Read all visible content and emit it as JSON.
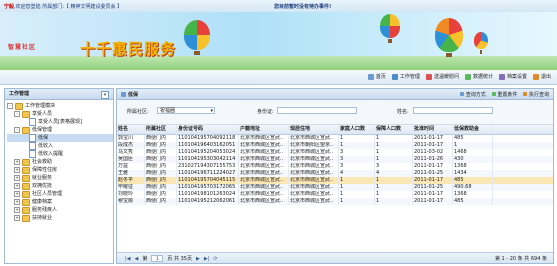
{
  "topbar": {
    "greeting_user": "宁毅",
    "greeting_rest": ",欢迎您登陆  所属部门:【 精神文明建设委员会 】",
    "notice": "您目前暂时没有待办事件!"
  },
  "banner": {
    "slogan": "智慧社区",
    "title": "十千惠民服务"
  },
  "toolbar": {
    "items": [
      "首页",
      "工作管理",
      "送温暖慰问",
      "数据统计",
      "档案设置",
      "退出"
    ]
  },
  "sidebar": {
    "title": "工作管理",
    "tree": [
      {
        "label": "工作管理模块",
        "level": 0,
        "type": "folder",
        "exp": "-"
      },
      {
        "label": "享受人员",
        "level": 1,
        "type": "folder",
        "exp": "-"
      },
      {
        "label": "享受人员[表格展现]",
        "level": 2,
        "type": "page"
      },
      {
        "label": "低保管理",
        "level": 1,
        "type": "folder",
        "exp": "-"
      },
      {
        "label": "低保",
        "level": 2,
        "type": "page",
        "selected": true
      },
      {
        "label": "低收入",
        "level": 2,
        "type": "page"
      },
      {
        "label": "低收入提醒",
        "level": 2,
        "type": "page"
      },
      {
        "label": "社会救助",
        "level": 1,
        "type": "folder",
        "exp": "+"
      },
      {
        "label": "保障性住房",
        "level": 1,
        "type": "folder",
        "exp": "+"
      },
      {
        "label": "就业服务",
        "level": 1,
        "type": "folder",
        "exp": "+"
      },
      {
        "label": "双拥优抚",
        "level": 1,
        "type": "folder",
        "exp": "+"
      },
      {
        "label": "社区人员管理",
        "level": 1,
        "type": "folder",
        "exp": "+"
      },
      {
        "label": "健康档案",
        "level": 1,
        "type": "folder",
        "exp": "+"
      },
      {
        "label": "服务残疾人",
        "level": 1,
        "type": "folder",
        "exp": "+"
      },
      {
        "label": "扶持就业",
        "level": 1,
        "type": "folder",
        "exp": "+"
      }
    ]
  },
  "main": {
    "title": "低保",
    "actions": [
      "查询方式",
      "重置条件",
      "执行查询"
    ],
    "filter": {
      "community_label": "所属社区:",
      "community_value": "祝福圈",
      "id_label": "身份证:",
      "name_label": "姓名:"
    },
    "columns": [
      "姓名",
      "所属社区",
      "身份证号码",
      "户籍地址",
      "现居住地",
      "家庭人口数",
      "保障人口数",
      "批准时间",
      "低保救助金"
    ],
    "rows": [
      [
        "郭宝川",
        "西便门内",
        "110104195704092118",
        "北京市西城区宣武..",
        "北京市西城区宣武..",
        "1",
        "1",
        "2011-01-17",
        "485"
      ],
      [
        "段成杰",
        "西便门内",
        "110104196403162051",
        "北京市西城区宣武..",
        "北京市朝阳区望京..",
        "1",
        "1",
        "2011-01-17",
        "1",
        ""
      ],
      [
        "马文秀",
        "西便门内",
        "110104195204053024",
        "北京市西城区宣武..",
        "北京市西城区宣武..",
        "3",
        "1",
        "2011-03-02",
        "1468"
      ],
      [
        "吴国臣",
        "西便门内",
        "110104195303042114",
        "北京市西城区宣武..",
        "北京市西城区宣武..",
        "3",
        "1",
        "2011-01-26",
        "430"
      ],
      [
        "万益",
        "西便门内",
        "231027194307155753",
        "北京市西城区宣武..",
        "北京市西城区宣武..",
        "3",
        "3",
        "2011-01-17",
        "1368"
      ],
      [
        "王雅",
        "西便门内",
        "110104196711224027",
        "北京市西城区宣武..",
        "北京市西城区宣武..",
        "4",
        "4",
        "2011-01-25",
        "1434"
      ],
      [
        "赵冬平",
        "西便门内",
        "110104195704045115",
        "北京市西城区宣武..",
        "北京市西城区宣武..",
        "1",
        "1",
        "2011-01-17",
        "485"
      ],
      [
        "毕曜征",
        "西便门内",
        "110104195703172065",
        "北京市西城区宣武..",
        "北京市西城区宣武..",
        "1",
        "1",
        "2011-01-25",
        "490.68"
      ],
      [
        "刘晓玲",
        "西便门内",
        "110104198101263024",
        "北京市西城区宣武..",
        "北京市西城区宣武..",
        "1",
        "1",
        "2011-01-17",
        "1368"
      ],
      [
        "穆宝顺",
        "西便门内",
        "110104195212062061",
        "北京市西城区宣武..",
        "北京市西城区宣武..",
        "1",
        "1",
        "2011-01-17",
        "485"
      ]
    ],
    "pager": {
      "page_label": "第",
      "page_value": "1",
      "total_pages": "页 共 35页",
      "range": "第 1 - 20 条 共 694 条"
    }
  },
  "colors": {
    "accent": "#c9dcef",
    "highlight": "#fbe7b3",
    "title": "#f5b400"
  }
}
